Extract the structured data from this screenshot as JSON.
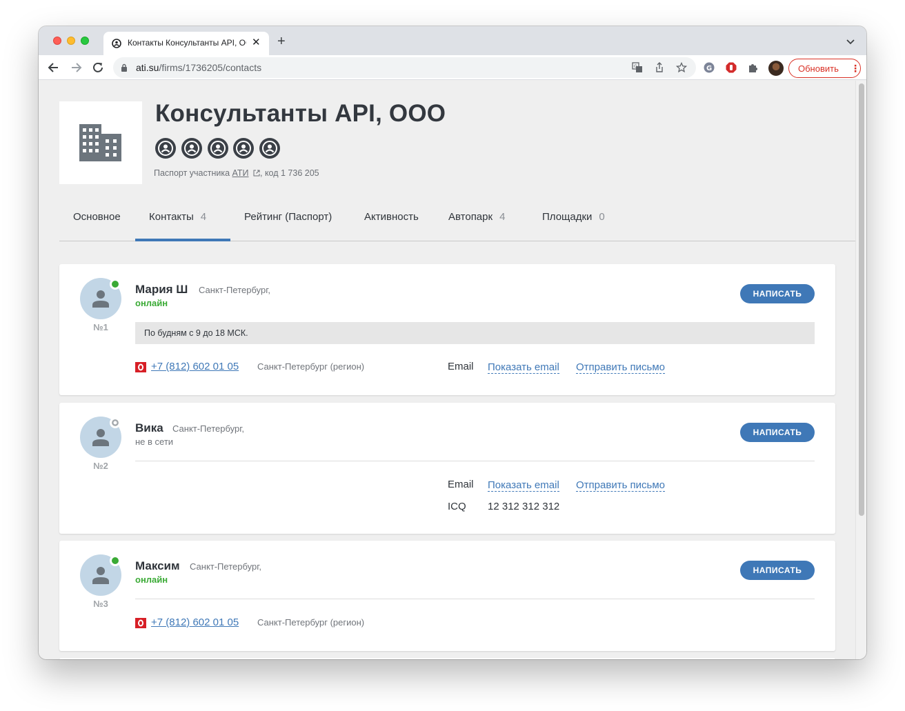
{
  "browser": {
    "tab_title": "Контакты Консультанты API, ООО",
    "tab_close": "✕",
    "new_tab": "+",
    "url_host": "ati.su",
    "url_path": "/firms/1736205/contacts",
    "update_label": "Обновить",
    "menu_dots": "⋮",
    "icons": [
      "back-icon",
      "forward-icon",
      "reload-icon",
      "lock-icon",
      "translate-icon",
      "share-icon",
      "bookmark-star-icon",
      "grammarly-icon",
      "adblock-icon",
      "extensions-icon",
      "profile-avatar-icon",
      "tab-search-icon"
    ]
  },
  "firm": {
    "name": "Консультанты API, ООО",
    "badges_count": 5,
    "passport_prefix": "Паспорт участника ",
    "passport_link": "АТИ",
    "passport_suffix": ", код 1 736 205"
  },
  "nav_tabs": [
    {
      "label": "Основное",
      "count": ""
    },
    {
      "label": "Контакты",
      "count": "4",
      "active": true
    },
    {
      "label": "Рейтинг (Паспорт)",
      "count": ""
    },
    {
      "label": "Активность",
      "count": ""
    },
    {
      "label": "Автопарк",
      "count": "4"
    },
    {
      "label": "Площадки",
      "count": "0"
    }
  ],
  "contacts": [
    {
      "number": "№1",
      "name": "Мария Ш",
      "city": "Санкт-Петербург,",
      "status": "онлайн",
      "online": true,
      "write_label": "НАПИСАТЬ",
      "note": "По будням с 9 до 18 МСК.",
      "phone": "+7 (812) 602 01 05",
      "region": "Санкт-Петербург (регион)",
      "email_label": "Email",
      "show_email": "Показать email",
      "send_letter": "Отправить письмо"
    },
    {
      "number": "№2",
      "name": "Вика",
      "city": "Санкт-Петербург,",
      "status": "не в сети",
      "online": false,
      "write_label": "НАПИСАТЬ",
      "email_label": "Email",
      "show_email": "Показать email",
      "send_letter": "Отправить письмо",
      "icq_label": "ICQ",
      "icq_value": "12 312 312 312"
    },
    {
      "number": "№3",
      "name": "Максим",
      "city": "Санкт-Петербург,",
      "status": "онлайн",
      "online": true,
      "write_label": "НАПИСАТЬ",
      "phone": "+7 (812) 602 01 05",
      "region": "Санкт-Петербург (регион)"
    }
  ],
  "colors": {
    "accent": "#3f78b7",
    "online": "#3aaa35",
    "update_red": "#d93025",
    "page_bg": "#efefef"
  }
}
